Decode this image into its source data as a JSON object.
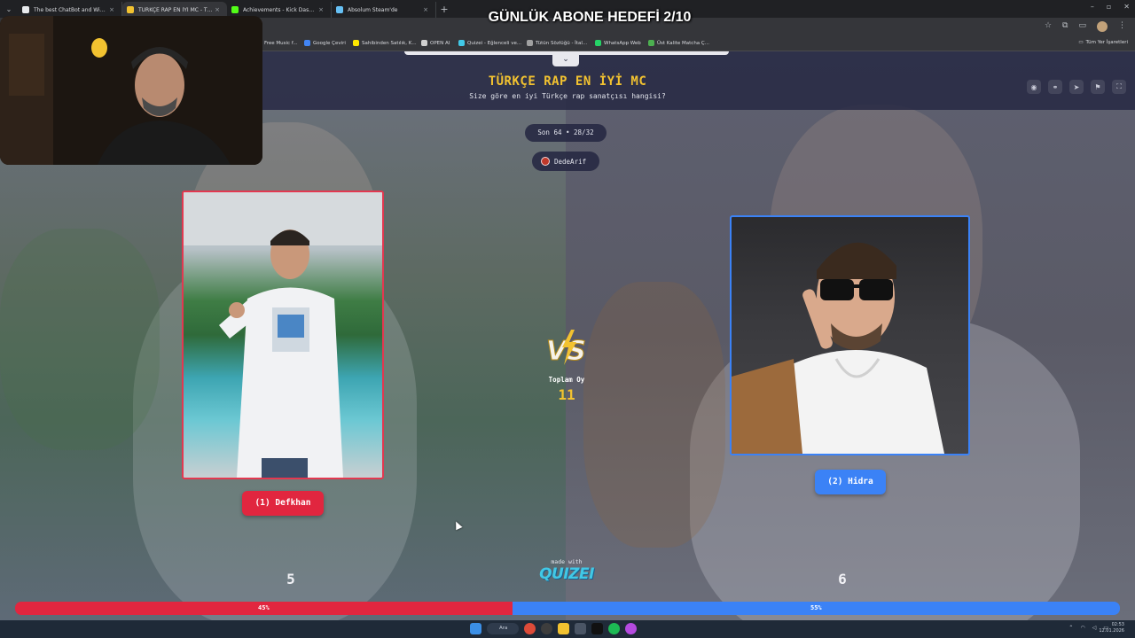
{
  "browser": {
    "tabs": [
      {
        "title": "The best ChatBot and Widgets",
        "favicon_color": "#e8eaed",
        "active": false
      },
      {
        "title": "TÜRKÇE RAP EN İYİ MC - Tier l",
        "favicon_color": "#f2c230",
        "active": true
      },
      {
        "title": "Achievements - Kick Dashboard",
        "favicon_color": "#53fc18",
        "active": false
      },
      {
        "title": "Absolum Steam'de",
        "favicon_color": "#66c0f4",
        "active": false
      }
    ],
    "new_tab_symbol": "+",
    "close_symbol": "×",
    "window_controls": [
      "–",
      "▫",
      "✕"
    ],
    "bookmarks": [
      {
        "label": "Free Music f...",
        "icon_color": "#8a8a8a"
      },
      {
        "label": "Google Çeviri",
        "icon_color": "#4285f4"
      },
      {
        "label": "Sahibinden Satılık, K...",
        "icon_color": "#ffe800"
      },
      {
        "label": "OPEN AI",
        "icon_color": "#cfcfcf"
      },
      {
        "label": "Quizei - Eğlenceli ve...",
        "icon_color": "#41c8e6"
      },
      {
        "label": "Tütün Sözlüğü - İtal...",
        "icon_color": "#a0a0a0"
      },
      {
        "label": "WhatsApp Web",
        "icon_color": "#25d366"
      },
      {
        "label": "Üst Kalite Matcha Ç...",
        "icon_color": "#4caf50"
      }
    ],
    "all_bookmarks_label": "Tüm Yer İşaretleri"
  },
  "stream": {
    "goal_text": "GÜNLÜK ABONE HEDEFİ 2/10"
  },
  "quiz": {
    "title": "TÜRKÇE RAP EN İYİ MC",
    "subtitle": "Size göre en iyi Türkçe rap sanatçısı hangisi?",
    "round": "Son 64 • 28/32",
    "creator": "DedeArif",
    "total_label": "Toplam Oy",
    "total_votes": "11",
    "vs_text": "VS",
    "made_with_label": "made with",
    "brand": "QUIZEI",
    "left": {
      "label": "(1) Defkhan",
      "votes": "5",
      "percent_label": "45%",
      "share": 45,
      "color": "#e1263f"
    },
    "right": {
      "label": "(2) Hidra",
      "votes": "6",
      "percent_label": "55%",
      "share": 55,
      "color": "#3b82f6"
    }
  },
  "taskbar": {
    "search_label": "Ara",
    "clock_time": "02:53",
    "clock_date": "12.01.2026"
  }
}
